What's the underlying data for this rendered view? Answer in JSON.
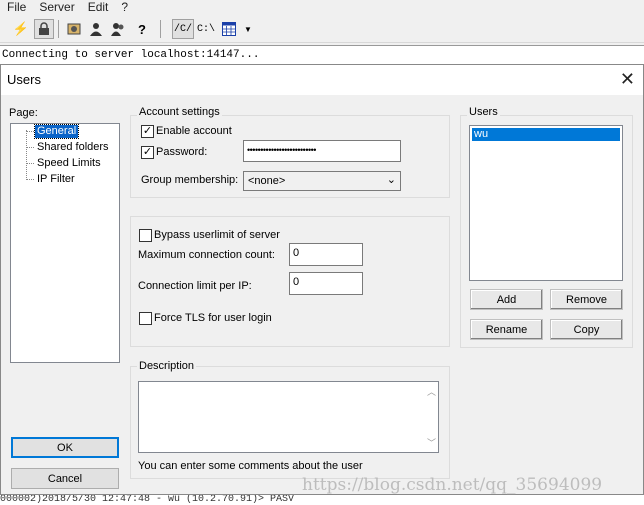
{
  "app": {
    "menu": [
      "File",
      "Server",
      "Edit",
      "?"
    ],
    "toolbar_icons": [
      "lightning-icon",
      "lock-icon",
      "settings-icon",
      "users-icon",
      "groups-icon",
      "help-icon",
      "dir-unix-icon",
      "dir-windows-icon",
      "grid-icon",
      "dropdown-icon"
    ],
    "toolbar_text": {
      "unix": "/C/",
      "win": "C:\\"
    },
    "log_line": "Connecting to server localhost:14147...",
    "bottom_log": "000002)2018/5/30 12:47:48 - wu (10.2.70.91)> PASV"
  },
  "dialog": {
    "title": "Users",
    "page_label": "Page:",
    "pages": [
      "General",
      "Shared folders",
      "Speed Limits",
      "IP Filter"
    ],
    "selected_page": "General",
    "ok": "OK",
    "cancel": "Cancel",
    "account_settings": {
      "title": "Account settings",
      "enable_account": "Enable account",
      "enable_checked": "✓",
      "password_label": "Password:",
      "password_checked": "✓",
      "password_value": "••••••••••••••••••••••••••",
      "group_label": "Group membership:",
      "group_value": "<none>"
    },
    "limits": {
      "bypass": "Bypass userlimit of server",
      "max_conn_label": "Maximum connection count:",
      "max_conn_value": "0",
      "per_ip_label": "Connection limit per IP:",
      "per_ip_value": "0",
      "force_tls": "Force TLS for user login"
    },
    "description": {
      "title": "Description",
      "hint": "You can enter some comments about the user"
    },
    "users": {
      "title": "Users",
      "list": [
        "wu"
      ],
      "add": "Add",
      "remove": "Remove",
      "rename": "Rename",
      "copy": "Copy"
    }
  },
  "watermark": "https://blog.csdn.net/qq_35694099"
}
